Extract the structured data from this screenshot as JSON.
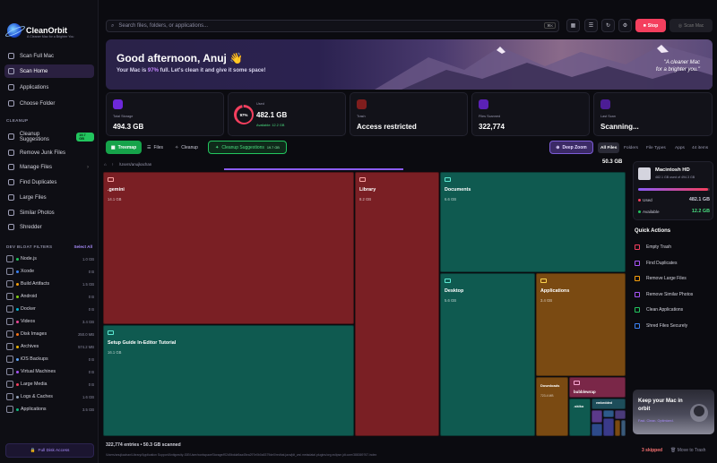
{
  "app": {
    "name": "CleanOrbit",
    "tagline": "A Cleaner Mac for a Brighter You"
  },
  "sidebar": {
    "nav": [
      {
        "label": "Scan Full Mac",
        "icon": "scan-icon"
      },
      {
        "label": "Scan Home",
        "icon": "home-icon",
        "active": true
      },
      {
        "label": "Applications",
        "icon": "apps-icon"
      },
      {
        "label": "Choose Folder",
        "icon": "folder-icon"
      }
    ],
    "cleanup_title": "CLEANUP",
    "cleanup": [
      {
        "label": "Cleanup Suggestions",
        "badge": "19.7 GB"
      },
      {
        "label": "Remove Junk Files"
      },
      {
        "label": "Manage Files",
        "chevron": true
      },
      {
        "label": "Find Duplicates"
      },
      {
        "label": "Large Files"
      },
      {
        "label": "Similar Photos"
      },
      {
        "label": "Shredder"
      }
    ],
    "bloat_title": "DEV BLOAT FILTERS",
    "select_all": "Select All",
    "bloat": [
      {
        "label": "Node.js",
        "size": "1.0 GB",
        "color": "#22c55e"
      },
      {
        "label": "Xcode",
        "size": "0 B",
        "color": "#3b82f6"
      },
      {
        "label": "Build Artifacts",
        "size": "1.5 GB",
        "color": "#f59e0b"
      },
      {
        "label": "Android",
        "size": "0 B",
        "color": "#84cc16"
      },
      {
        "label": "Docker",
        "size": "0 B",
        "color": "#06b6d4"
      },
      {
        "label": "Videos",
        "size": "3.4 GB",
        "color": "#ec4899"
      },
      {
        "label": "Disk Images",
        "size": "250.0 MB",
        "color": "#f97316"
      },
      {
        "label": "Archives",
        "size": "574.2 MB",
        "color": "#eab308"
      },
      {
        "label": "iOS Backups",
        "size": "0 B",
        "color": "#60a5fa"
      },
      {
        "label": "Virtual Machines",
        "size": "0 B",
        "color": "#a855f7"
      },
      {
        "label": "Large Media",
        "size": "0 B",
        "color": "#f43f5e"
      },
      {
        "label": "Logs & Caches",
        "size": "1.6 GB",
        "color": "#94a3b8"
      },
      {
        "label": "Applications",
        "size": "3.5 GB",
        "color": "#10b981"
      }
    ],
    "fda_button": "Full Disk Access"
  },
  "topbar": {
    "search_placeholder": "Search files, folders, or applications...",
    "shortcut": "⌘K",
    "stop_label": "Stop",
    "scan_mac_label": "Scan Mac"
  },
  "hero": {
    "greeting": "Good afternoon, Anuj 👋",
    "sub_prefix": "Your Mac is ",
    "sub_pct": "97%",
    "sub_suffix": " full. Let's clean it and give it some space!",
    "quote_line1": "\"A cleaner Mac",
    "quote_line2": "for a brighter you.\""
  },
  "stats": {
    "total_label": "Total Storage",
    "total_value": "494.3 GB",
    "used_label": "Used",
    "used_value": "482.1 GB",
    "used_pct": "97%",
    "available": "Available: 12.2 GB",
    "trash_label": "Trash",
    "trash_value": "Access restricted",
    "scanned_label": "Files Scanned",
    "scanned_value": "322,774",
    "last_label": "Last Scan",
    "last_value": "Scanning..."
  },
  "tabs": {
    "treemap": "Treemap",
    "files": "Files",
    "cleanup": "Cleanup",
    "suggestions": "Cleanup Suggestions",
    "suggestions_badge": "19.7 GB",
    "deep_zoom": "Deep Zoom",
    "views": [
      "All Files",
      "Folders",
      "File Types",
      "Apps"
    ],
    "count": "44 items"
  },
  "path": {
    "text": "/Users/anujkachan",
    "size": "50.3 GB"
  },
  "treemap": [
    {
      "name": ".gemini",
      "size": "14.1 GB",
      "kind": "red"
    },
    {
      "name": "Setup Guide In-Editor Tutorial",
      "size": "16.1 GB",
      "kind": "teal"
    },
    {
      "name": "Library",
      "size": "8.2 GB",
      "kind": "red"
    },
    {
      "name": "Documents",
      "size": "6.6 GB",
      "kind": "teal"
    },
    {
      "name": "Desktop",
      "size": "5.6 GB",
      "kind": "teal"
    },
    {
      "name": "Applications",
      "size": "3.4 GB",
      "kind": "amber"
    },
    {
      "name": "Downloads",
      "size": "723.4 MB",
      "kind": "amber"
    },
    {
      "name": "bubblewrap",
      "size": "",
      "kind": "pink"
    },
    {
      "name": ".skiko",
      "size": "",
      "kind": "teal"
    },
    {
      "name": "embedded",
      "size": "",
      "kind": "teal"
    }
  ],
  "status": {
    "summary": "322,774 entries • 50.3 GB scanned",
    "current_path": "/Users/anujkachan/Library/Application Support/Antigravity-IDE/User/workspaceStorage/f02d5bdda9aa45ea297e0b0a5379de0/redhat.java/jdt_ws/.metadata/.plugins/org.eclipse.jdt.core/388369767.index",
    "skipped": "3 skipped",
    "move_trash": "Move to Trash"
  },
  "disk": {
    "name": "Macintosh HD",
    "sub": "482.1 GB used of 494.3 GB",
    "used_label": "Used",
    "used_value": "482.1 GB",
    "avail_label": "Available",
    "avail_value": "12.2 GB",
    "fill": 0.97
  },
  "quick_actions": {
    "title": "Quick Actions",
    "items": [
      {
        "label": "Empty Trash",
        "color": "#f43f5e"
      },
      {
        "label": "Find Duplicates",
        "color": "#a855f7"
      },
      {
        "label": "Remove Large Files",
        "color": "#f59e0b"
      },
      {
        "label": "Remove Similar Photos",
        "color": "#a855f7"
      },
      {
        "label": "Clean Applications",
        "color": "#22c55e"
      },
      {
        "label": "Shred Files Securely",
        "color": "#3b82f6"
      }
    ]
  },
  "promo": {
    "title": "Keep your Mac in orbit",
    "sub": "Fast. Clean. Optimized."
  }
}
